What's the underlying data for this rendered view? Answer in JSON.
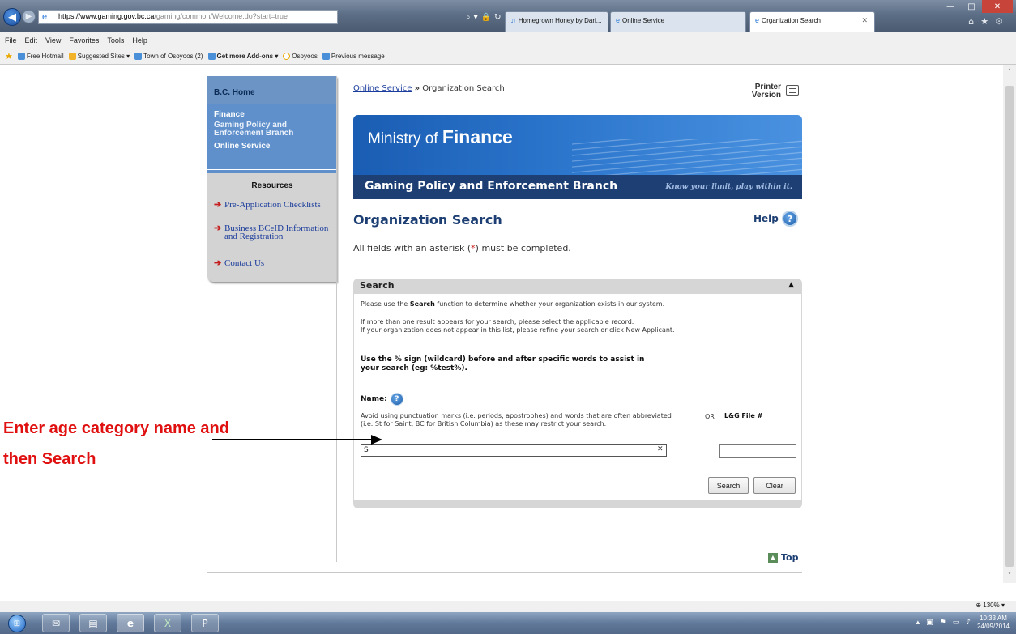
{
  "browser": {
    "url_scheme": "https://",
    "url_sub": "www.",
    "url_domain": "gaming.gov.bc.ca",
    "url_path": "/gaming/common/Welcome.do?start=true",
    "tabs": [
      {
        "label": "Homegrown Honey by Dari..."
      },
      {
        "label": "Online Service"
      },
      {
        "label": "Organization Search"
      }
    ],
    "menu": [
      "File",
      "Edit",
      "View",
      "Favorites",
      "Tools",
      "Help"
    ],
    "favorites": [
      {
        "label": "Free Hotmail"
      },
      {
        "label": "Suggested Sites ▾"
      },
      {
        "label": "Town of Osoyoos (2)"
      },
      {
        "label": "Get more Add-ons ▾"
      },
      {
        "label": "Osoyoos"
      },
      {
        "label": "Previous message"
      }
    ],
    "zoom": "130%",
    "clock_time": "10:33 AM",
    "clock_date": "24/09/2014"
  },
  "sidebar": {
    "home": "B.C. Home",
    "finance": "Finance",
    "gaming": "Gaming Policy and Enforcement Branch",
    "online": "Online Service",
    "resources_title": "Resources",
    "links": [
      {
        "label": "Pre-Application Checklists"
      },
      {
        "label": "Business BCeID Information and Registration"
      },
      {
        "label": "Contact Us"
      }
    ]
  },
  "breadcrumb": {
    "link": "Online Service",
    "sep": "»",
    "current": "Organization Search"
  },
  "printer": {
    "line1": "Printer",
    "line2": "Version"
  },
  "banner": {
    "ministry_prefix": "Ministry of",
    "ministry_name": "Finance",
    "branch": "Gaming Policy and Enforcement Branch",
    "tagline": "Know your limit, play within it."
  },
  "page": {
    "title": "Organization Search",
    "help": "Help",
    "note_before": "All fields with an asterisk (",
    "note_star": "*",
    "note_after": ") must be completed."
  },
  "search": {
    "header": "Search",
    "intro_pre": "Please use the ",
    "intro_bold": "Search",
    "intro_post": " function to determine whether your organization exists in our system.",
    "multi_line1": "If more than one result appears for your search, please select the applicable record.",
    "multi_line2": "If your organization does not appear in this list, please refine your search or click New Applicant.",
    "wildcard_line1": "Use the % sign (wildcard) before and after specific words to assist in",
    "wildcard_line2": "your search (eg: %test%).",
    "name_label": "Name:",
    "avoid_text": "Avoid using punctuation marks (i.e. periods, apostrophes) and words that are often abbreviated (i.e. St for Saint, BC for British Columbia) as these may restrict your search.",
    "or_label": "OR",
    "lg_label": "L&G File #",
    "name_value": "S",
    "lg_value": "",
    "search_button": "Search",
    "clear_button": "Clear"
  },
  "top_link": "Top",
  "annotation": {
    "line1": "Enter age category name and",
    "line2": "then Search"
  }
}
